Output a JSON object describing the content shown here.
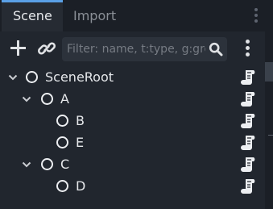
{
  "tabs": [
    {
      "label": "Scene",
      "active": true
    },
    {
      "label": "Import",
      "active": false
    }
  ],
  "toolbar": {
    "add_icon": "plus-icon",
    "link_icon": "link-icon",
    "filter_placeholder": "Filter: name, t:type, g:group",
    "filter_value": "",
    "search_icon": "search-icon",
    "more_icon": "vertical-dots-icon"
  },
  "tree": [
    {
      "label": "SceneRoot",
      "depth": 0,
      "expanded": true,
      "has_children": true,
      "script": true
    },
    {
      "label": "A",
      "depth": 1,
      "expanded": true,
      "has_children": true,
      "script": true
    },
    {
      "label": "B",
      "depth": 2,
      "expanded": false,
      "has_children": false,
      "script": true
    },
    {
      "label": "E",
      "depth": 2,
      "expanded": false,
      "has_children": false,
      "script": true
    },
    {
      "label": "C",
      "depth": 1,
      "expanded": true,
      "has_children": true,
      "script": true
    },
    {
      "label": "D",
      "depth": 2,
      "expanded": false,
      "has_children": false,
      "script": true
    }
  ],
  "colors": {
    "panel_bg": "#21262e",
    "tab_accent": "#5aa0e6",
    "text": "#e6e8eb",
    "muted_text": "#8a8f96"
  }
}
